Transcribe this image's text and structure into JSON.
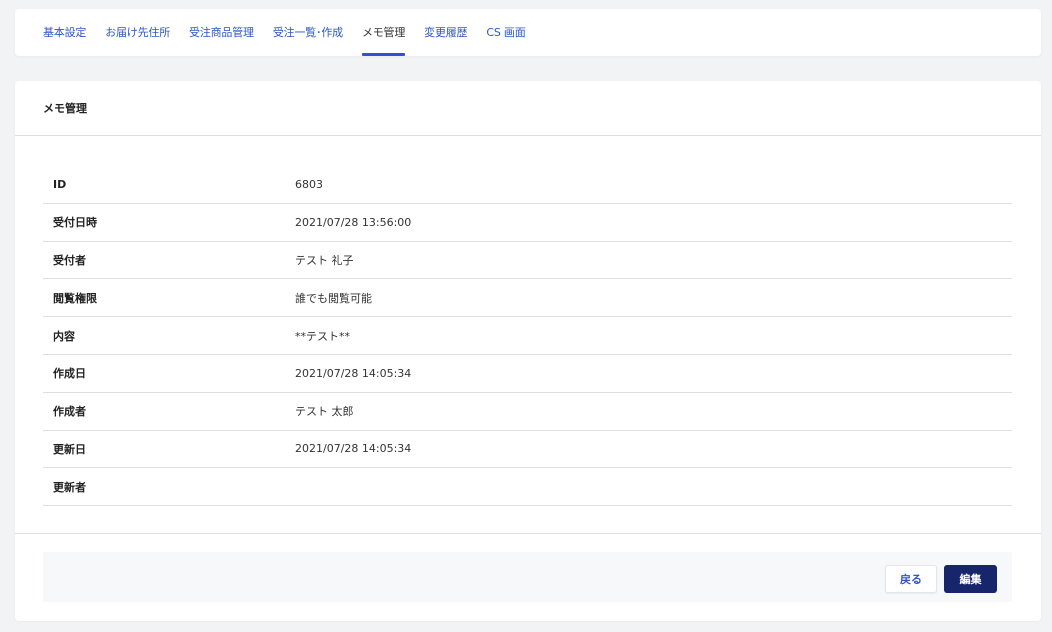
{
  "tabs": [
    {
      "label": "基本設定",
      "active": false
    },
    {
      "label": "お届け先住所",
      "active": false
    },
    {
      "label": "受注商品管理",
      "active": false
    },
    {
      "label": "受注一覧･作成",
      "active": false
    },
    {
      "label": "メモ管理",
      "active": true
    },
    {
      "label": "変更履歴",
      "active": false
    },
    {
      "label": "CS 画面",
      "active": false
    }
  ],
  "card": {
    "title": "メモ管理"
  },
  "detail": [
    {
      "label": "ID",
      "value": "6803"
    },
    {
      "label": "受付日時",
      "value": "2021/07/28 13:56:00"
    },
    {
      "label": "受付者",
      "value": "テスト 礼子"
    },
    {
      "label": "閲覧権限",
      "value": "誰でも閲覧可能"
    },
    {
      "label": "内容",
      "value": "**テスト**"
    },
    {
      "label": "作成日",
      "value": "2021/07/28 14:05:34"
    },
    {
      "label": "作成者",
      "value": "テスト 太郎"
    },
    {
      "label": "更新日",
      "value": "2021/07/28 14:05:34"
    },
    {
      "label": "更新者",
      "value": ""
    }
  ],
  "actions": {
    "back_label": "戻る",
    "edit_label": "編集"
  },
  "colors": {
    "accent": "#2d55c9",
    "primary_button": "#17256b",
    "background": "#f2f3f5"
  }
}
